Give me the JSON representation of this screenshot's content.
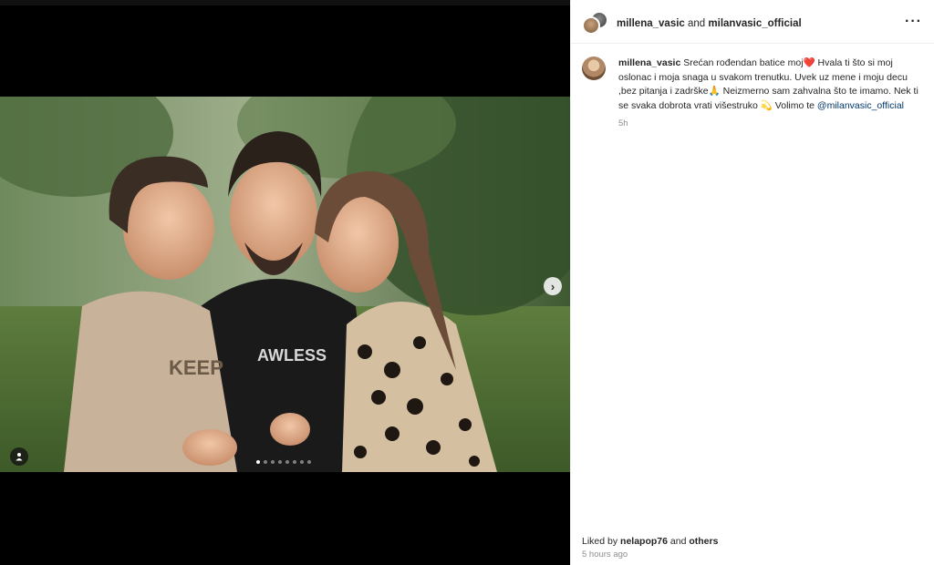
{
  "post": {
    "carousel": {
      "slide_count": 8,
      "active_index": 0,
      "next_icon": "chevron-right-icon",
      "tag_icon": "person-icon"
    }
  },
  "header": {
    "user1": "millena_vasic",
    "joiner": "and",
    "user2": "milanvasic_official",
    "more_icon": "more-horizontal-icon"
  },
  "caption": {
    "username": "millena_vasic",
    "text": "Srećan rođendan batice moj❤️ Hvala ti što si moj oslonac i moja snaga u svakom trenutku. Uvek uz mene i moju decu ,bez pitanja i zadrške🙏 Neizmerno sam zahvalna što te imamo. Nek ti se svaka dobrota vrati višestruko 💫 Volimo te",
    "mention": "@milanvasic_official",
    "time": "5h"
  },
  "footer": {
    "liked_by_prefix": "Liked by",
    "liked_by_user": "nelapop76",
    "liked_and": "and",
    "liked_others": "others",
    "timestamp": "5 hours ago"
  },
  "colors": {
    "link": "#00376b",
    "text": "#262626",
    "secondary": "#8e8e8e"
  }
}
